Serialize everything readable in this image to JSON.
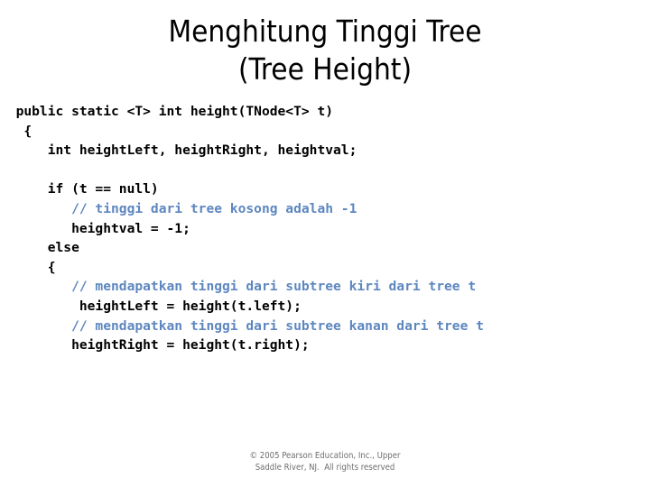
{
  "slide": {
    "background_color": "#ffffff",
    "title": {
      "lines": [
        "Menghitung Tinggi Tree",
        "(Tree Height)"
      ],
      "color": "#000000"
    },
    "code": {
      "text_color": "#000000",
      "comment_color": "#5d87bf",
      "language": "java",
      "lines": [
        {
          "indent": 2,
          "type": "code",
          "text": "public static <T> int height(TNode<T> t)"
        },
        {
          "indent": 3,
          "type": "code",
          "text": "{"
        },
        {
          "indent": 6,
          "type": "code",
          "text": "int heightLeft, heightRight, heightval;"
        },
        {
          "indent": 0,
          "type": "blank",
          "text": ""
        },
        {
          "indent": 6,
          "type": "code",
          "text": "if (t == null)"
        },
        {
          "indent": 9,
          "type": "comment",
          "text": "// tinggi dari tree kosong adalah -1"
        },
        {
          "indent": 9,
          "type": "code",
          "text": "heightval = -1;"
        },
        {
          "indent": 6,
          "type": "code",
          "text": "else"
        },
        {
          "indent": 6,
          "type": "code",
          "text": "{"
        },
        {
          "indent": 9,
          "type": "comment",
          "text": "// mendapatkan tinggi dari subtree kiri dari tree t"
        },
        {
          "indent": 9,
          "type": "code",
          "text": " heightLeft = height(t.left);"
        },
        {
          "indent": 9,
          "type": "comment",
          "text": "// mendapatkan tinggi dari subtree kanan dari tree t"
        },
        {
          "indent": 9,
          "type": "code",
          "text": "heightRight = height(t.right);"
        }
      ]
    },
    "footer": {
      "lines": [
        "© 2005 Pearson Education, Inc., Upper",
        "Saddle River, NJ.  All rights reserved"
      ],
      "color": "#6e6e6e"
    }
  }
}
